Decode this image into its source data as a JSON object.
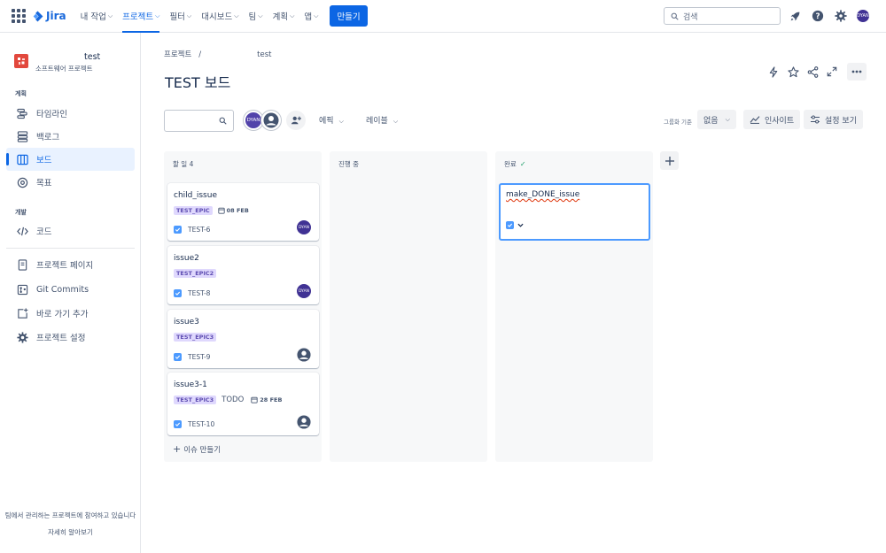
{
  "topbar": {
    "product": "Jira",
    "nav": [
      {
        "label": "내 작업",
        "active": false
      },
      {
        "label": "프로젝트",
        "active": true
      },
      {
        "label": "필터",
        "active": false
      },
      {
        "label": "대시보드",
        "active": false
      },
      {
        "label": "팀",
        "active": false
      },
      {
        "label": "계획",
        "active": false
      },
      {
        "label": "앱",
        "active": false
      }
    ],
    "create_label": "만들기",
    "search_placeholder": "검색",
    "user_initials": "DYAN",
    "icons": [
      "app-switcher-icon",
      "rocket-icon",
      "help-icon",
      "settings-icon"
    ]
  },
  "sidebar": {
    "project_name": "test",
    "project_type": "소프트웨어 프로젝트",
    "planning_label": "계획",
    "planning_items": [
      {
        "label": "타임라인",
        "icon": "timeline-icon"
      },
      {
        "label": "백로그",
        "icon": "backlog-icon"
      },
      {
        "label": "보드",
        "icon": "board-icon",
        "selected": true
      },
      {
        "label": "목표",
        "icon": "goals-icon"
      }
    ],
    "dev_label": "개발",
    "dev_items": [
      {
        "label": "코드",
        "icon": "code-icon"
      }
    ],
    "extra_items": [
      {
        "label": "프로젝트 페이지",
        "icon": "page-icon"
      },
      {
        "label": "Git Commits",
        "icon": "git-icon"
      },
      {
        "label": "바로 가기 추가",
        "icon": "add-shortcut-icon"
      },
      {
        "label": "프로젝트 설정",
        "icon": "gear-icon"
      }
    ],
    "footer_text": "팀에서 관리하는 프로젝트에 참여하고 있습니다",
    "footer_link": "자세히 알아보기"
  },
  "main": {
    "breadcrumb_root": "프로젝트",
    "breadcrumb_sep": "/",
    "breadcrumb_current": "test",
    "title": "TEST 보드",
    "toolbar": {
      "avatar_initials": "DYAN",
      "epic_label": "에픽",
      "label_label": "레이블",
      "group_by_label": "그룹화 기준",
      "group_by_value": "없음",
      "insights_label": "인사이트",
      "view_settings_label": "설정 보기"
    }
  },
  "columns": [
    {
      "title": "할 일 4",
      "create_label": "이슈 만들기",
      "cards": [
        {
          "title": "child_issue",
          "epic": "TEST_EPIC",
          "date": "08 FEB",
          "key": "TEST-6",
          "assignee": "DYAN"
        },
        {
          "title": "issue2",
          "epic": "TEST_EPIC2",
          "key": "TEST-8",
          "assignee": "DYAN"
        },
        {
          "title": "issue3",
          "epic": "TEST_EPIC3",
          "key": "TEST-9",
          "assignee": "unassigned"
        },
        {
          "title": "issue3-1",
          "epic": "TEST_EPIC3",
          "label": "TODO",
          "date": "28 FEB",
          "key": "TEST-10",
          "assignee": "unassigned"
        }
      ]
    },
    {
      "title": "진행 중",
      "cards": []
    },
    {
      "title": "완료",
      "done": true,
      "new_issue_text": "make_DONE_issue"
    }
  ],
  "colors": {
    "accent": "#0c66e4",
    "epic_bg": "#dfd8fd",
    "epic_text": "#5e4db2",
    "avatar": "#403294",
    "done_check": "#22a06b"
  }
}
